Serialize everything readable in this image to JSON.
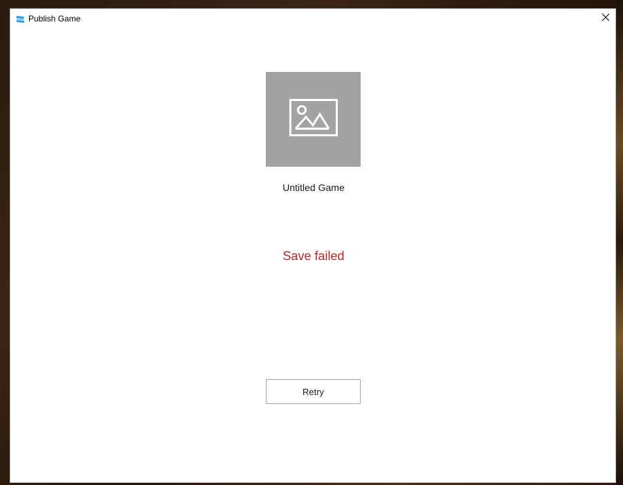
{
  "window": {
    "title": "Publish Game",
    "close_icon": "close-icon",
    "app_icon": "roblox-studio-icon"
  },
  "game": {
    "thumbnail_icon": "image-placeholder-icon",
    "name": "Untitled Game"
  },
  "status": {
    "message": "Save failed",
    "color": "#b12a2a"
  },
  "actions": {
    "retry_label": "Retry"
  },
  "colors": {
    "thumbnail_bg": "#a3a3a3",
    "app_icon": "#2b9ae6"
  }
}
